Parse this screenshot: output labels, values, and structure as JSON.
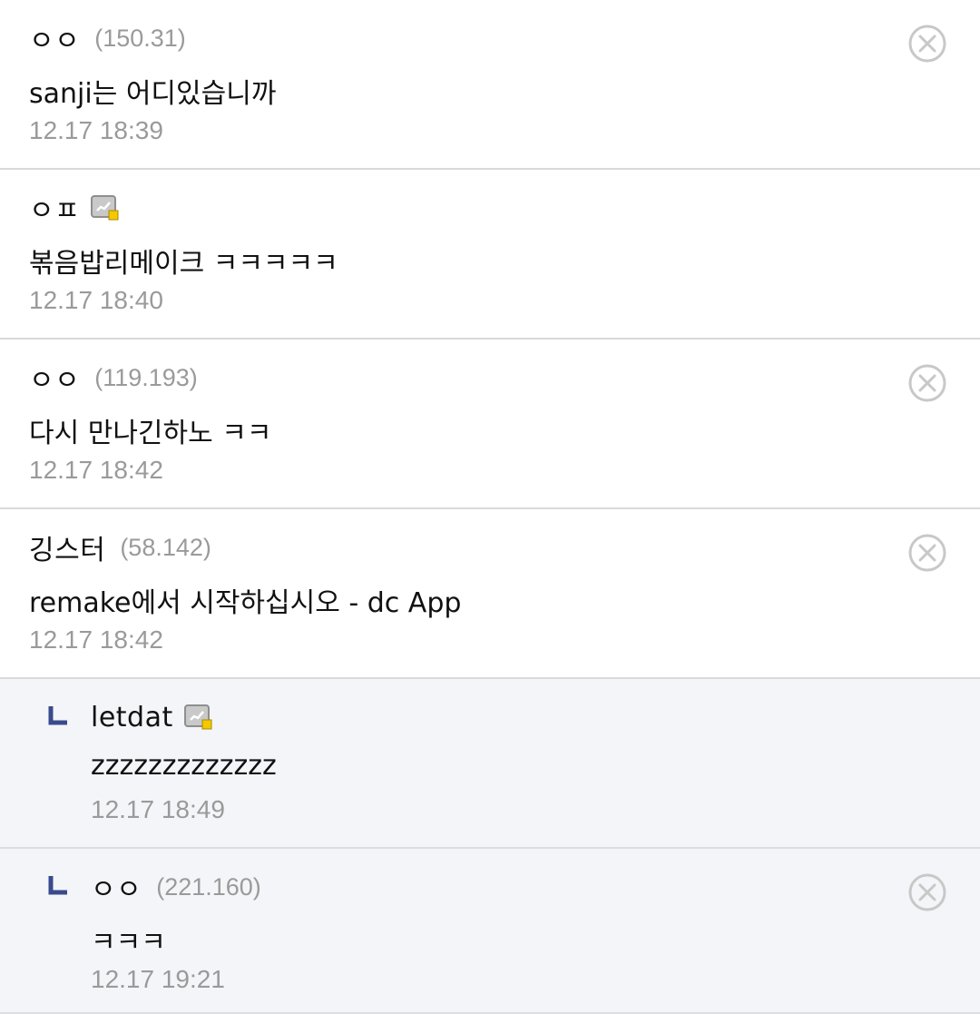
{
  "comments": [
    {
      "nick": "ㅇㅇ",
      "ip": "(150.31)",
      "body": "sanji는 어디있습니까",
      "time": "12.17 18:39",
      "deletable": true,
      "member_icon": false,
      "reply": false
    },
    {
      "nick": "ㅇㅍ",
      "ip": "",
      "body": "볶음밥리메이크 ㅋㅋㅋㅋㅋ",
      "time": "12.17 18:40",
      "deletable": false,
      "member_icon": true,
      "reply": false
    },
    {
      "nick": "ㅇㅇ",
      "ip": "(119.193)",
      "body": "다시 만나긴하노 ㅋㅋ",
      "time": "12.17 18:42",
      "deletable": true,
      "member_icon": false,
      "reply": false
    },
    {
      "nick": "깅스터",
      "ip": "(58.142)",
      "body": "remake에서 시작하십시오 - dc App",
      "time": "12.17 18:42",
      "deletable": true,
      "member_icon": false,
      "reply": false
    },
    {
      "nick": "letdat",
      "ip": "",
      "body": "zzzzzzzzzzzzz",
      "time": "12.17 18:49",
      "deletable": false,
      "member_icon": true,
      "reply": true
    },
    {
      "nick": "ㅇㅇ",
      "ip": "(221.160)",
      "body": "ㅋㅋㅋ",
      "time": "12.17 19:21",
      "deletable": true,
      "member_icon": false,
      "reply": true
    }
  ],
  "icons": {
    "delete": "close-circle-icon",
    "member": "gallog-member-icon",
    "reply": "reply-arrow-icon"
  },
  "colors": {
    "text": "#111111",
    "meta": "#9a9a9a",
    "divider": "#d9d9d9",
    "reply_bg": "#f4f5f9",
    "reply_mark": "#3a4a8c",
    "member_icon_badge": "#f5c800"
  }
}
